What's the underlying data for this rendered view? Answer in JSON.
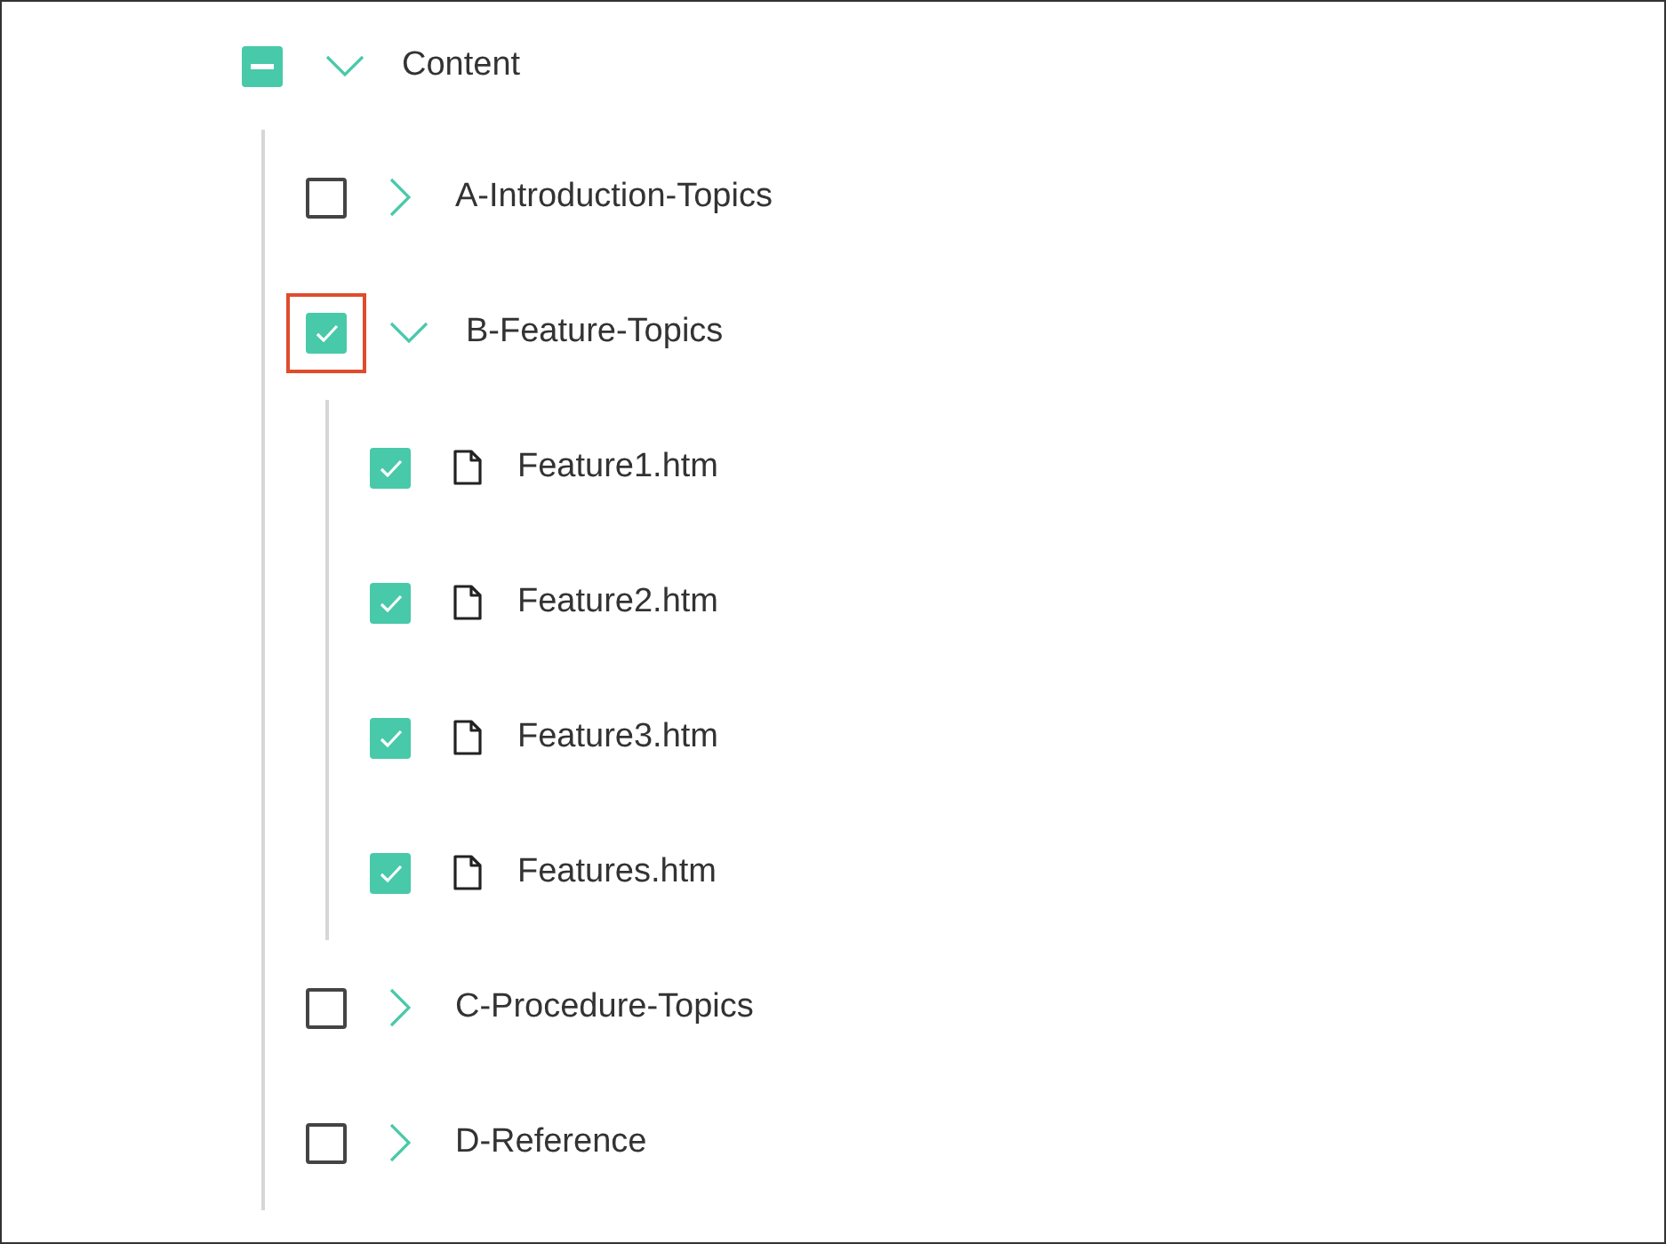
{
  "tree": [
    {
      "label": "Content",
      "kind": "folder",
      "indeterminate": true,
      "highlighted": false,
      "expanded": true,
      "children": [
        {
          "label": "A-Introduction-Topics",
          "kind": "folder",
          "checked": false,
          "highlighted": false,
          "expanded": false
        },
        {
          "label": "B-Feature-Topics",
          "kind": "folder",
          "checked": true,
          "highlighted": true,
          "expanded": true,
          "children": [
            {
              "label": "Feature1.htm",
              "kind": "file",
              "checked": true,
              "highlighted": false
            },
            {
              "label": "Feature2.htm",
              "kind": "file",
              "checked": true,
              "highlighted": false
            },
            {
              "label": "Feature3.htm",
              "kind": "file",
              "checked": true,
              "highlighted": false
            },
            {
              "label": "Features.htm",
              "kind": "file",
              "checked": true,
              "highlighted": false
            }
          ]
        },
        {
          "label": "C-Procedure-Topics",
          "kind": "folder",
          "checked": false,
          "highlighted": false,
          "expanded": false
        },
        {
          "label": "D-Reference",
          "kind": "folder",
          "checked": false,
          "highlighted": false,
          "expanded": false
        }
      ]
    }
  ]
}
